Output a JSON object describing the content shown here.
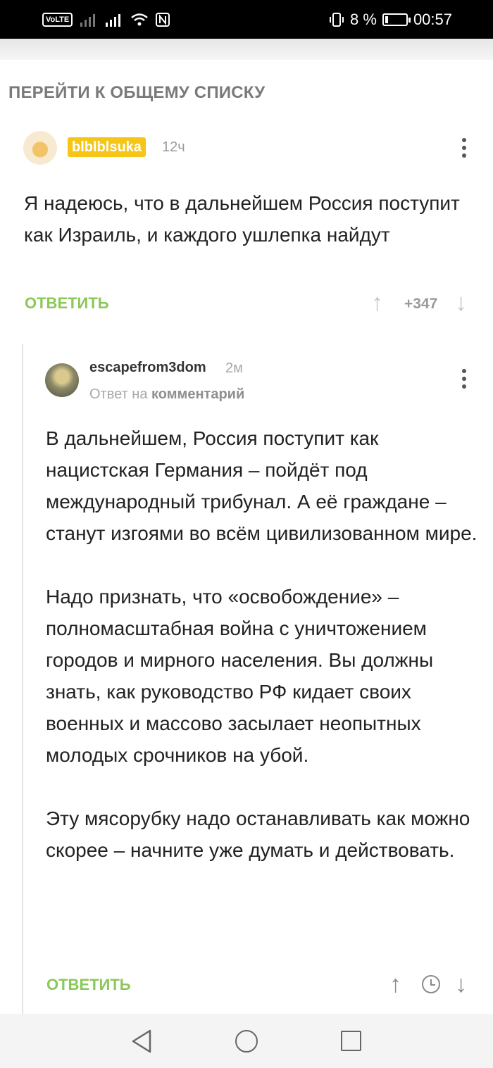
{
  "status_bar": {
    "volte": "VoLTE 2",
    "battery": "8 %",
    "time": "00:57"
  },
  "back_link": "ПЕРЕЙТИ К ОБЩЕМУ СПИСКУ",
  "comment1": {
    "author": "blblblsuka",
    "time": "12ч",
    "text": "Я надеюсь, что в дальнейшем Россия поступит как Израиль, и каждого ушлепка найдут",
    "reply_label": "ОТВЕТИТЬ",
    "score": "+347"
  },
  "comment2": {
    "author": "escapefrom3dom",
    "time": "2м",
    "reply_prefix": "Ответ на",
    "reply_target": "комментарий",
    "paragraphs": [
      "В дальнейшем, Россия поступит как нацистская Германия – пойдёт под международный трибунал. А её граждане – станут изгоями во всём цивилизованном мире.",
      "Надо признать, что «освобождение» – полномасштабная война с уничтожением городов и мирного населения. Вы должны знать, как руководство РФ кидает своих военных и массово засылает неопытных молодых срочников на убой.",
      "Эту мясорубку надо останавливать как можно скорее – начните уже думать и действовать."
    ],
    "reply_label": "ОТВЕТИТЬ"
  },
  "icons": {
    "more": "more-vert-icon",
    "upvote": "arrow-up-icon",
    "downvote": "arrow-down-icon",
    "clock": "clock-icon",
    "nav_back": "nav-back-icon",
    "nav_home": "nav-home-icon",
    "nav_recent": "nav-recent-icon"
  },
  "colors": {
    "accent_green": "#8ac858",
    "nick_badge": "#f5c518"
  }
}
